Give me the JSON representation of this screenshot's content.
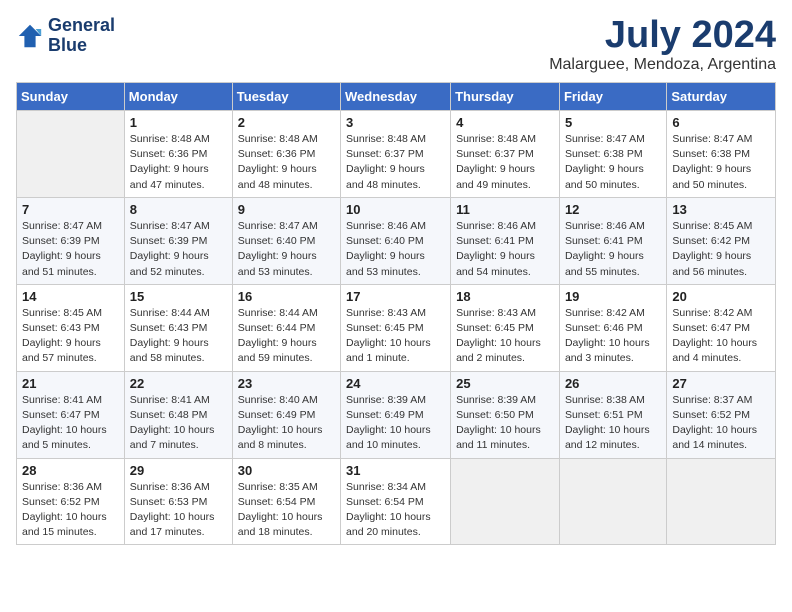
{
  "header": {
    "logo_line1": "General",
    "logo_line2": "Blue",
    "month": "July 2024",
    "location": "Malarguee, Mendoza, Argentina"
  },
  "days_of_week": [
    "Sunday",
    "Monday",
    "Tuesday",
    "Wednesday",
    "Thursday",
    "Friday",
    "Saturday"
  ],
  "weeks": [
    [
      {
        "day": "",
        "sunrise": "",
        "sunset": "",
        "daylight": "",
        "empty": true
      },
      {
        "day": "1",
        "sunrise": "Sunrise: 8:48 AM",
        "sunset": "Sunset: 6:36 PM",
        "daylight": "Daylight: 9 hours and 47 minutes."
      },
      {
        "day": "2",
        "sunrise": "Sunrise: 8:48 AM",
        "sunset": "Sunset: 6:36 PM",
        "daylight": "Daylight: 9 hours and 48 minutes."
      },
      {
        "day": "3",
        "sunrise": "Sunrise: 8:48 AM",
        "sunset": "Sunset: 6:37 PM",
        "daylight": "Daylight: 9 hours and 48 minutes."
      },
      {
        "day": "4",
        "sunrise": "Sunrise: 8:48 AM",
        "sunset": "Sunset: 6:37 PM",
        "daylight": "Daylight: 9 hours and 49 minutes."
      },
      {
        "day": "5",
        "sunrise": "Sunrise: 8:47 AM",
        "sunset": "Sunset: 6:38 PM",
        "daylight": "Daylight: 9 hours and 50 minutes."
      },
      {
        "day": "6",
        "sunrise": "Sunrise: 8:47 AM",
        "sunset": "Sunset: 6:38 PM",
        "daylight": "Daylight: 9 hours and 50 minutes."
      }
    ],
    [
      {
        "day": "7",
        "sunrise": "Sunrise: 8:47 AM",
        "sunset": "Sunset: 6:39 PM",
        "daylight": "Daylight: 9 hours and 51 minutes."
      },
      {
        "day": "8",
        "sunrise": "Sunrise: 8:47 AM",
        "sunset": "Sunset: 6:39 PM",
        "daylight": "Daylight: 9 hours and 52 minutes."
      },
      {
        "day": "9",
        "sunrise": "Sunrise: 8:47 AM",
        "sunset": "Sunset: 6:40 PM",
        "daylight": "Daylight: 9 hours and 53 minutes."
      },
      {
        "day": "10",
        "sunrise": "Sunrise: 8:46 AM",
        "sunset": "Sunset: 6:40 PM",
        "daylight": "Daylight: 9 hours and 53 minutes."
      },
      {
        "day": "11",
        "sunrise": "Sunrise: 8:46 AM",
        "sunset": "Sunset: 6:41 PM",
        "daylight": "Daylight: 9 hours and 54 minutes."
      },
      {
        "day": "12",
        "sunrise": "Sunrise: 8:46 AM",
        "sunset": "Sunset: 6:41 PM",
        "daylight": "Daylight: 9 hours and 55 minutes."
      },
      {
        "day": "13",
        "sunrise": "Sunrise: 8:45 AM",
        "sunset": "Sunset: 6:42 PM",
        "daylight": "Daylight: 9 hours and 56 minutes."
      }
    ],
    [
      {
        "day": "14",
        "sunrise": "Sunrise: 8:45 AM",
        "sunset": "Sunset: 6:43 PM",
        "daylight": "Daylight: 9 hours and 57 minutes."
      },
      {
        "day": "15",
        "sunrise": "Sunrise: 8:44 AM",
        "sunset": "Sunset: 6:43 PM",
        "daylight": "Daylight: 9 hours and 58 minutes."
      },
      {
        "day": "16",
        "sunrise": "Sunrise: 8:44 AM",
        "sunset": "Sunset: 6:44 PM",
        "daylight": "Daylight: 9 hours and 59 minutes."
      },
      {
        "day": "17",
        "sunrise": "Sunrise: 8:43 AM",
        "sunset": "Sunset: 6:45 PM",
        "daylight": "Daylight: 10 hours and 1 minute."
      },
      {
        "day": "18",
        "sunrise": "Sunrise: 8:43 AM",
        "sunset": "Sunset: 6:45 PM",
        "daylight": "Daylight: 10 hours and 2 minutes."
      },
      {
        "day": "19",
        "sunrise": "Sunrise: 8:42 AM",
        "sunset": "Sunset: 6:46 PM",
        "daylight": "Daylight: 10 hours and 3 minutes."
      },
      {
        "day": "20",
        "sunrise": "Sunrise: 8:42 AM",
        "sunset": "Sunset: 6:47 PM",
        "daylight": "Daylight: 10 hours and 4 minutes."
      }
    ],
    [
      {
        "day": "21",
        "sunrise": "Sunrise: 8:41 AM",
        "sunset": "Sunset: 6:47 PM",
        "daylight": "Daylight: 10 hours and 5 minutes."
      },
      {
        "day": "22",
        "sunrise": "Sunrise: 8:41 AM",
        "sunset": "Sunset: 6:48 PM",
        "daylight": "Daylight: 10 hours and 7 minutes."
      },
      {
        "day": "23",
        "sunrise": "Sunrise: 8:40 AM",
        "sunset": "Sunset: 6:49 PM",
        "daylight": "Daylight: 10 hours and 8 minutes."
      },
      {
        "day": "24",
        "sunrise": "Sunrise: 8:39 AM",
        "sunset": "Sunset: 6:49 PM",
        "daylight": "Daylight: 10 hours and 10 minutes."
      },
      {
        "day": "25",
        "sunrise": "Sunrise: 8:39 AM",
        "sunset": "Sunset: 6:50 PM",
        "daylight": "Daylight: 10 hours and 11 minutes."
      },
      {
        "day": "26",
        "sunrise": "Sunrise: 8:38 AM",
        "sunset": "Sunset: 6:51 PM",
        "daylight": "Daylight: 10 hours and 12 minutes."
      },
      {
        "day": "27",
        "sunrise": "Sunrise: 8:37 AM",
        "sunset": "Sunset: 6:52 PM",
        "daylight": "Daylight: 10 hours and 14 minutes."
      }
    ],
    [
      {
        "day": "28",
        "sunrise": "Sunrise: 8:36 AM",
        "sunset": "Sunset: 6:52 PM",
        "daylight": "Daylight: 10 hours and 15 minutes."
      },
      {
        "day": "29",
        "sunrise": "Sunrise: 8:36 AM",
        "sunset": "Sunset: 6:53 PM",
        "daylight": "Daylight: 10 hours and 17 minutes."
      },
      {
        "day": "30",
        "sunrise": "Sunrise: 8:35 AM",
        "sunset": "Sunset: 6:54 PM",
        "daylight": "Daylight: 10 hours and 18 minutes."
      },
      {
        "day": "31",
        "sunrise": "Sunrise: 8:34 AM",
        "sunset": "Sunset: 6:54 PM",
        "daylight": "Daylight: 10 hours and 20 minutes."
      },
      {
        "day": "",
        "sunrise": "",
        "sunset": "",
        "daylight": "",
        "empty": true
      },
      {
        "day": "",
        "sunrise": "",
        "sunset": "",
        "daylight": "",
        "empty": true
      },
      {
        "day": "",
        "sunrise": "",
        "sunset": "",
        "daylight": "",
        "empty": true
      }
    ]
  ]
}
